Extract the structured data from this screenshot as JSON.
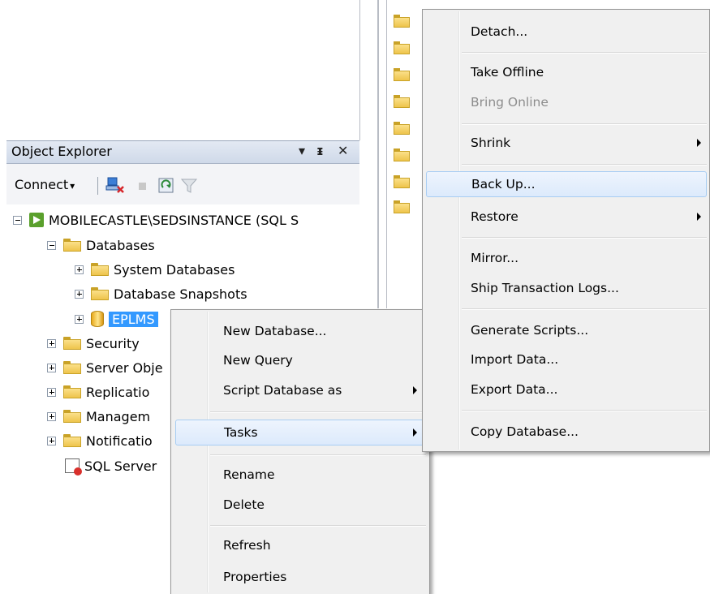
{
  "object_explorer": {
    "title": "Object Explorer",
    "pin_glyph": "▾ ⊥",
    "close_glyph": "✕",
    "toolbar": {
      "connect_label": "Connect",
      "connect_dropdown": "▾"
    },
    "tree": {
      "server": "MOBILECASTLE\\SEDSINSTANCE (SQL S",
      "databases": "Databases",
      "system_databases": "System Databases",
      "database_snapshots": "Database Snapshots",
      "eplms": "EPLMS",
      "security": "Security",
      "server_objects": "Server Obje",
      "replication": "Replicatio",
      "management": "Managem",
      "notification": "Notificatio",
      "sql_server_agent": "SQL Server"
    }
  },
  "right_pane_folders": [
    "",
    "",
    "",
    "",
    "",
    "",
    "",
    ""
  ],
  "context_menu": {
    "items": {
      "new_database": "New Database...",
      "new_query": "New Query",
      "script_database_as": "Script Database as",
      "tasks": "Tasks",
      "rename": "Rename",
      "delete": "Delete",
      "refresh": "Refresh",
      "properties": "Properties"
    }
  },
  "tasks_submenu": {
    "items": {
      "detach": "Detach...",
      "take_offline": "Take Offline",
      "bring_online": "Bring Online",
      "shrink": "Shrink",
      "back_up": "Back Up...",
      "restore": "Restore",
      "mirror": "Mirror...",
      "ship_transaction_logs": "Ship Transaction Logs...",
      "generate_scripts": "Generate Scripts...",
      "import_data": "Import Data...",
      "export_data": "Export Data...",
      "copy_database": "Copy Database..."
    }
  }
}
